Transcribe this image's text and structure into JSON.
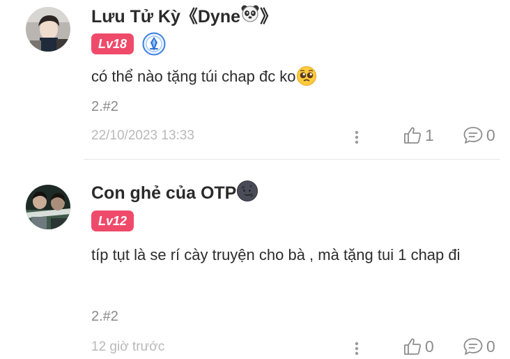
{
  "comments": [
    {
      "username": "Lưu Tử Kỳ《Dyne",
      "username_suffix": "》",
      "username_emoji": "panda-face",
      "level": "Lv18",
      "vip_icon": "blue-crest-badge-icon",
      "content": "có thể nào tặng túi chap đc ko",
      "content_emoji": "pleading-face",
      "floor": "2.#2",
      "timestamp": "22/10/2023 13:33",
      "likes": "1",
      "replies": "0"
    },
    {
      "username": "Con ghẻ của OTP",
      "username_emoji": "new-moon-face",
      "level": "Lv12",
      "content": "típ tụt là se rí cày truyện cho bà , mà tặng tui 1 chap đi",
      "floor": "2.#2",
      "timestamp": "12 giờ trước",
      "likes": "0",
      "replies": "0"
    }
  ],
  "colors": {
    "level_badge": "#ef4a6a",
    "muted_text": "#8c8c8c",
    "timestamp_text": "#b9b9b9",
    "divider": "#e6e6e6"
  }
}
